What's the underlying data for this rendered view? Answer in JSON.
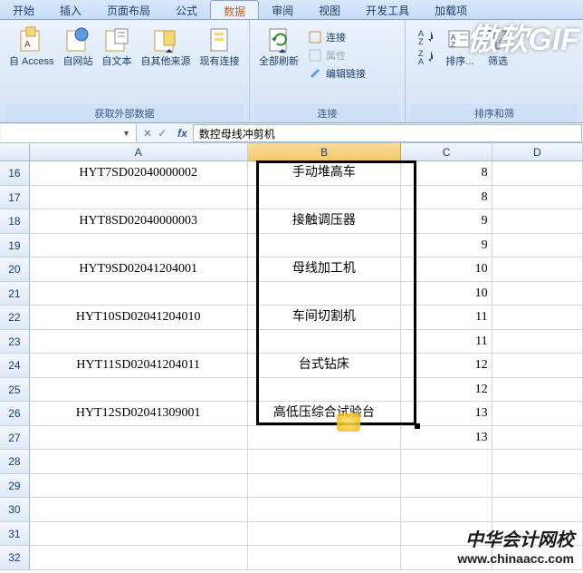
{
  "ribbon": {
    "tabs": [
      "开始",
      "插入",
      "页面布局",
      "公式",
      "数据",
      "审阅",
      "视图",
      "开发工具",
      "加载项"
    ],
    "active_tab": 4,
    "groups": {
      "external": {
        "label": "获取外部数据",
        "buttons": {
          "access": "自 Access",
          "web": "自网站",
          "text": "自文本",
          "other": "自其他来源",
          "existing": "现有连接"
        }
      },
      "connections": {
        "label": "连接",
        "refresh": "全部刷新",
        "conn": "连接",
        "props": "属性",
        "edit_links": "编辑链接"
      },
      "sort": {
        "label": "排序和筛",
        "sort_btn": "排序...",
        "filter_btn": "筛选"
      }
    }
  },
  "formula_bar": {
    "name_box": "",
    "value": "数控母线冲剪机"
  },
  "columns": [
    "A",
    "B",
    "C",
    "D"
  ],
  "rows": [
    {
      "n": 16,
      "A": "HYT7SD02040000002",
      "B": "手动堆高车",
      "C": "8"
    },
    {
      "n": 17,
      "A": "",
      "B": "",
      "C": "8"
    },
    {
      "n": 18,
      "A": "HYT8SD02040000003",
      "B": "接触调压器",
      "C": "9"
    },
    {
      "n": 19,
      "A": "",
      "B": "",
      "C": "9"
    },
    {
      "n": 20,
      "A": "HYT9SD02041204001",
      "B": "母线加工机",
      "C": "10"
    },
    {
      "n": 21,
      "A": "",
      "B": "",
      "C": "10"
    },
    {
      "n": 22,
      "A": "HYT10SD02041204010",
      "B": "车间切割机",
      "C": "11"
    },
    {
      "n": 23,
      "A": "",
      "B": "",
      "C": "11"
    },
    {
      "n": 24,
      "A": "HYT11SD02041204011",
      "B": "台式钻床",
      "C": "12"
    },
    {
      "n": 25,
      "A": "",
      "B": "",
      "C": "12"
    },
    {
      "n": 26,
      "A": "HYT12SD02041309001",
      "B": "高低压综合试验台",
      "C": "13"
    },
    {
      "n": 27,
      "A": "",
      "B": "",
      "C": "13"
    },
    {
      "n": 28,
      "A": "",
      "B": "",
      "C": ""
    },
    {
      "n": 29,
      "A": "",
      "B": "",
      "C": ""
    },
    {
      "n": 30,
      "A": "",
      "B": "",
      "C": ""
    },
    {
      "n": 31,
      "A": "",
      "B": "",
      "C": ""
    },
    {
      "n": 32,
      "A": "",
      "B": "",
      "C": ""
    }
  ],
  "watermarks": {
    "top": "傲软GIF",
    "bottom_line1": "中华会计网校",
    "bottom_line2": "www.chinaacc.com"
  }
}
